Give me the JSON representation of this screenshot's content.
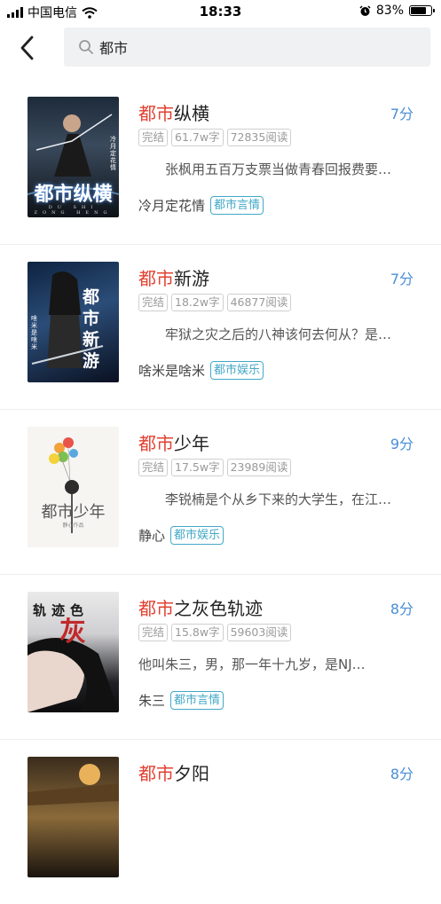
{
  "status": {
    "carrier": "中国电信",
    "time": "18:33",
    "battery": "83%",
    "battery_level": 0.83
  },
  "search": {
    "query": "都市"
  },
  "books": [
    {
      "title_highlight": "都市",
      "title_rest": "纵横",
      "score": "7分",
      "status": "完结",
      "words": "61.7w字",
      "reads": "72835阅读",
      "desc": "张枫用五百万支票当做青春回报费要…",
      "author": "冷月定花情",
      "category": "都市言情",
      "cover_title": "都市纵横",
      "cover_pinyin": "DU SHI ZONG HENG",
      "cover_author": "冷月定花情"
    },
    {
      "title_highlight": "都市",
      "title_rest": "新游",
      "score": "7分",
      "status": "完结",
      "words": "18.2w字",
      "reads": "46877阅读",
      "desc": "牢狱之灾之后的八神该何去何从？是…",
      "author": "啥米是啥米",
      "category": "都市娱乐",
      "cover_title": "都市新游",
      "cover_author": "啥米是啥米"
    },
    {
      "title_highlight": "都市",
      "title_rest": "少年",
      "score": "9分",
      "status": "完结",
      "words": "17.5w字",
      "reads": "23989阅读",
      "desc": "李锐楠是个从乡下来的大学生，在江…",
      "author": "静心",
      "category": "都市娱乐",
      "cover_title": "都市少年",
      "cover_author": "静心作品"
    },
    {
      "title_highlight": "都市",
      "title_rest": "之灰色轨迹",
      "score": "8分",
      "status": "完结",
      "words": "15.8w字",
      "reads": "59603阅读",
      "desc": "他叫朱三，男，那一年十九岁，是NJ…",
      "author": "朱三",
      "category": "都市言情",
      "cover_title": "轨迹色",
      "cover_title_big": "灰"
    },
    {
      "title_highlight": "都市",
      "title_rest": "夕阳",
      "score": "8分"
    }
  ]
}
